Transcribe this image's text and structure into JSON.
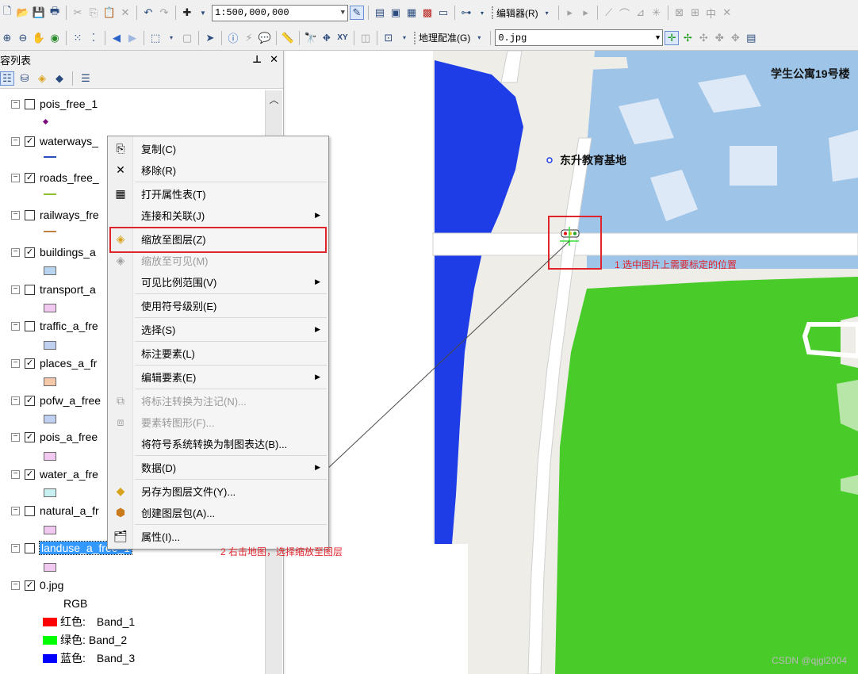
{
  "toolbar": {
    "scale_value": "1:500,000,000",
    "editor_label": "编辑器(R)",
    "georef_label": "地理配准(G)",
    "georef_layer": "0.jpg"
  },
  "toc": {
    "title": "容列表",
    "layers": [
      {
        "name": "pois_free_1",
        "checked": false
      },
      {
        "name": "waterways_",
        "checked": true
      },
      {
        "name": "roads_free_",
        "checked": true
      },
      {
        "name": "railways_fre",
        "checked": false
      },
      {
        "name": "buildings_a",
        "checked": true
      },
      {
        "name": "transport_a",
        "checked": false
      },
      {
        "name": "traffic_a_fre",
        "checked": false
      },
      {
        "name": "places_a_fr",
        "checked": true
      },
      {
        "name": "pofw_a_free",
        "checked": true
      },
      {
        "name": "pois_a_free",
        "checked": true
      },
      {
        "name": "water_a_fre",
        "checked": true
      },
      {
        "name": "natural_a_fr",
        "checked": false
      },
      {
        "name": "landuse_a_free_1",
        "checked": false
      },
      {
        "name": "0.jpg",
        "checked": true
      }
    ],
    "raster_label": "RGB",
    "bands": [
      {
        "label": "红色:",
        "band": "Band_1",
        "color": "#ff0000"
      },
      {
        "label": "绿色:",
        "band": "Band_2",
        "color": "#00ff00"
      },
      {
        "label": "蓝色:",
        "band": "Band_3",
        "color": "#0000ff"
      }
    ]
  },
  "context_menu": {
    "items": [
      {
        "label": "复制(C)",
        "icon": "copy-icon",
        "enabled": true
      },
      {
        "label": "移除(R)",
        "icon": "remove-icon",
        "enabled": true
      },
      {
        "label": "打开属性表(T)",
        "icon": "table-icon",
        "enabled": true
      },
      {
        "label": "连接和关联(J)",
        "icon": "",
        "enabled": true,
        "submenu": true
      },
      {
        "label": "缩放至图层(Z)",
        "icon": "zoom-to-layer-icon",
        "enabled": true
      },
      {
        "label": "缩放至可见(M)",
        "icon": "zoom-visible-icon",
        "enabled": false
      },
      {
        "label": "可见比例范围(V)",
        "icon": "",
        "enabled": true,
        "submenu": true
      },
      {
        "label": "使用符号级别(E)",
        "icon": "",
        "enabled": true
      },
      {
        "label": "选择(S)",
        "icon": "",
        "enabled": true,
        "submenu": true
      },
      {
        "label": "标注要素(L)",
        "icon": "",
        "enabled": true
      },
      {
        "label": "编辑要素(E)",
        "icon": "",
        "enabled": true,
        "submenu": true
      },
      {
        "label": "将标注转换为注记(N)...",
        "icon": "convert-labels-icon",
        "enabled": false
      },
      {
        "label": "要素转图形(F)...",
        "icon": "features-to-graphics-icon",
        "enabled": false
      },
      {
        "label": "将符号系统转换为制图表达(B)...",
        "icon": "",
        "enabled": true
      },
      {
        "label": "数据(D)",
        "icon": "",
        "enabled": true,
        "submenu": true
      },
      {
        "label": "另存为图层文件(Y)...",
        "icon": "layer-file-icon",
        "enabled": true
      },
      {
        "label": "创建图层包(A)...",
        "icon": "layer-package-icon",
        "enabled": true
      },
      {
        "label": "属性(I)...",
        "icon": "properties-icon",
        "enabled": true
      }
    ]
  },
  "map": {
    "label_school": "东升教育基地",
    "label_dorm": "学生公寓19号楼",
    "colors": {
      "water": "#1f3de6",
      "building": "#9ec4e8",
      "green": "#49cc2a",
      "ground": "#eeede8",
      "road": "#ffffff"
    }
  },
  "annotations": {
    "step1": "1 选中图片上需要标定的位置",
    "step2": "2 右击地图，选择缩放至图层"
  },
  "watermark": "CSDN @qjgl2004"
}
